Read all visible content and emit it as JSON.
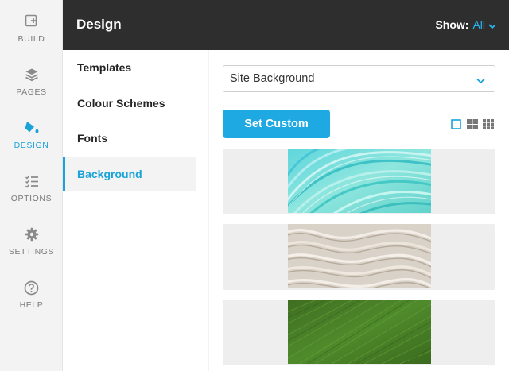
{
  "rail": {
    "items": [
      {
        "label": "BUILD",
        "icon": "build-icon"
      },
      {
        "label": "PAGES",
        "icon": "pages-icon"
      },
      {
        "label": "DESIGN",
        "icon": "design-icon",
        "active": true
      },
      {
        "label": "OPTIONS",
        "icon": "options-icon"
      },
      {
        "label": "SETTINGS",
        "icon": "settings-icon"
      },
      {
        "label": "HELP",
        "icon": "help-icon"
      }
    ]
  },
  "header": {
    "title": "Design",
    "show_label": "Show:",
    "show_value": "All"
  },
  "subnav": {
    "items": [
      {
        "label": "Templates"
      },
      {
        "label": "Colour Schemes"
      },
      {
        "label": "Fonts"
      },
      {
        "label": "Background",
        "active": true
      }
    ]
  },
  "main": {
    "select_value": "Site Background",
    "set_custom_label": "Set Custom",
    "view_modes": [
      "single-view-icon",
      "grid-2-view-icon",
      "grid-3-view-icon"
    ],
    "backgrounds": [
      {
        "name": "teal brush strokes"
      },
      {
        "name": "beige sand waves"
      },
      {
        "name": "green leaf texture"
      }
    ]
  },
  "colors": {
    "accent": "#1aa3d9",
    "header_bg": "#2e2e2e",
    "button": "#1fa9e2"
  }
}
